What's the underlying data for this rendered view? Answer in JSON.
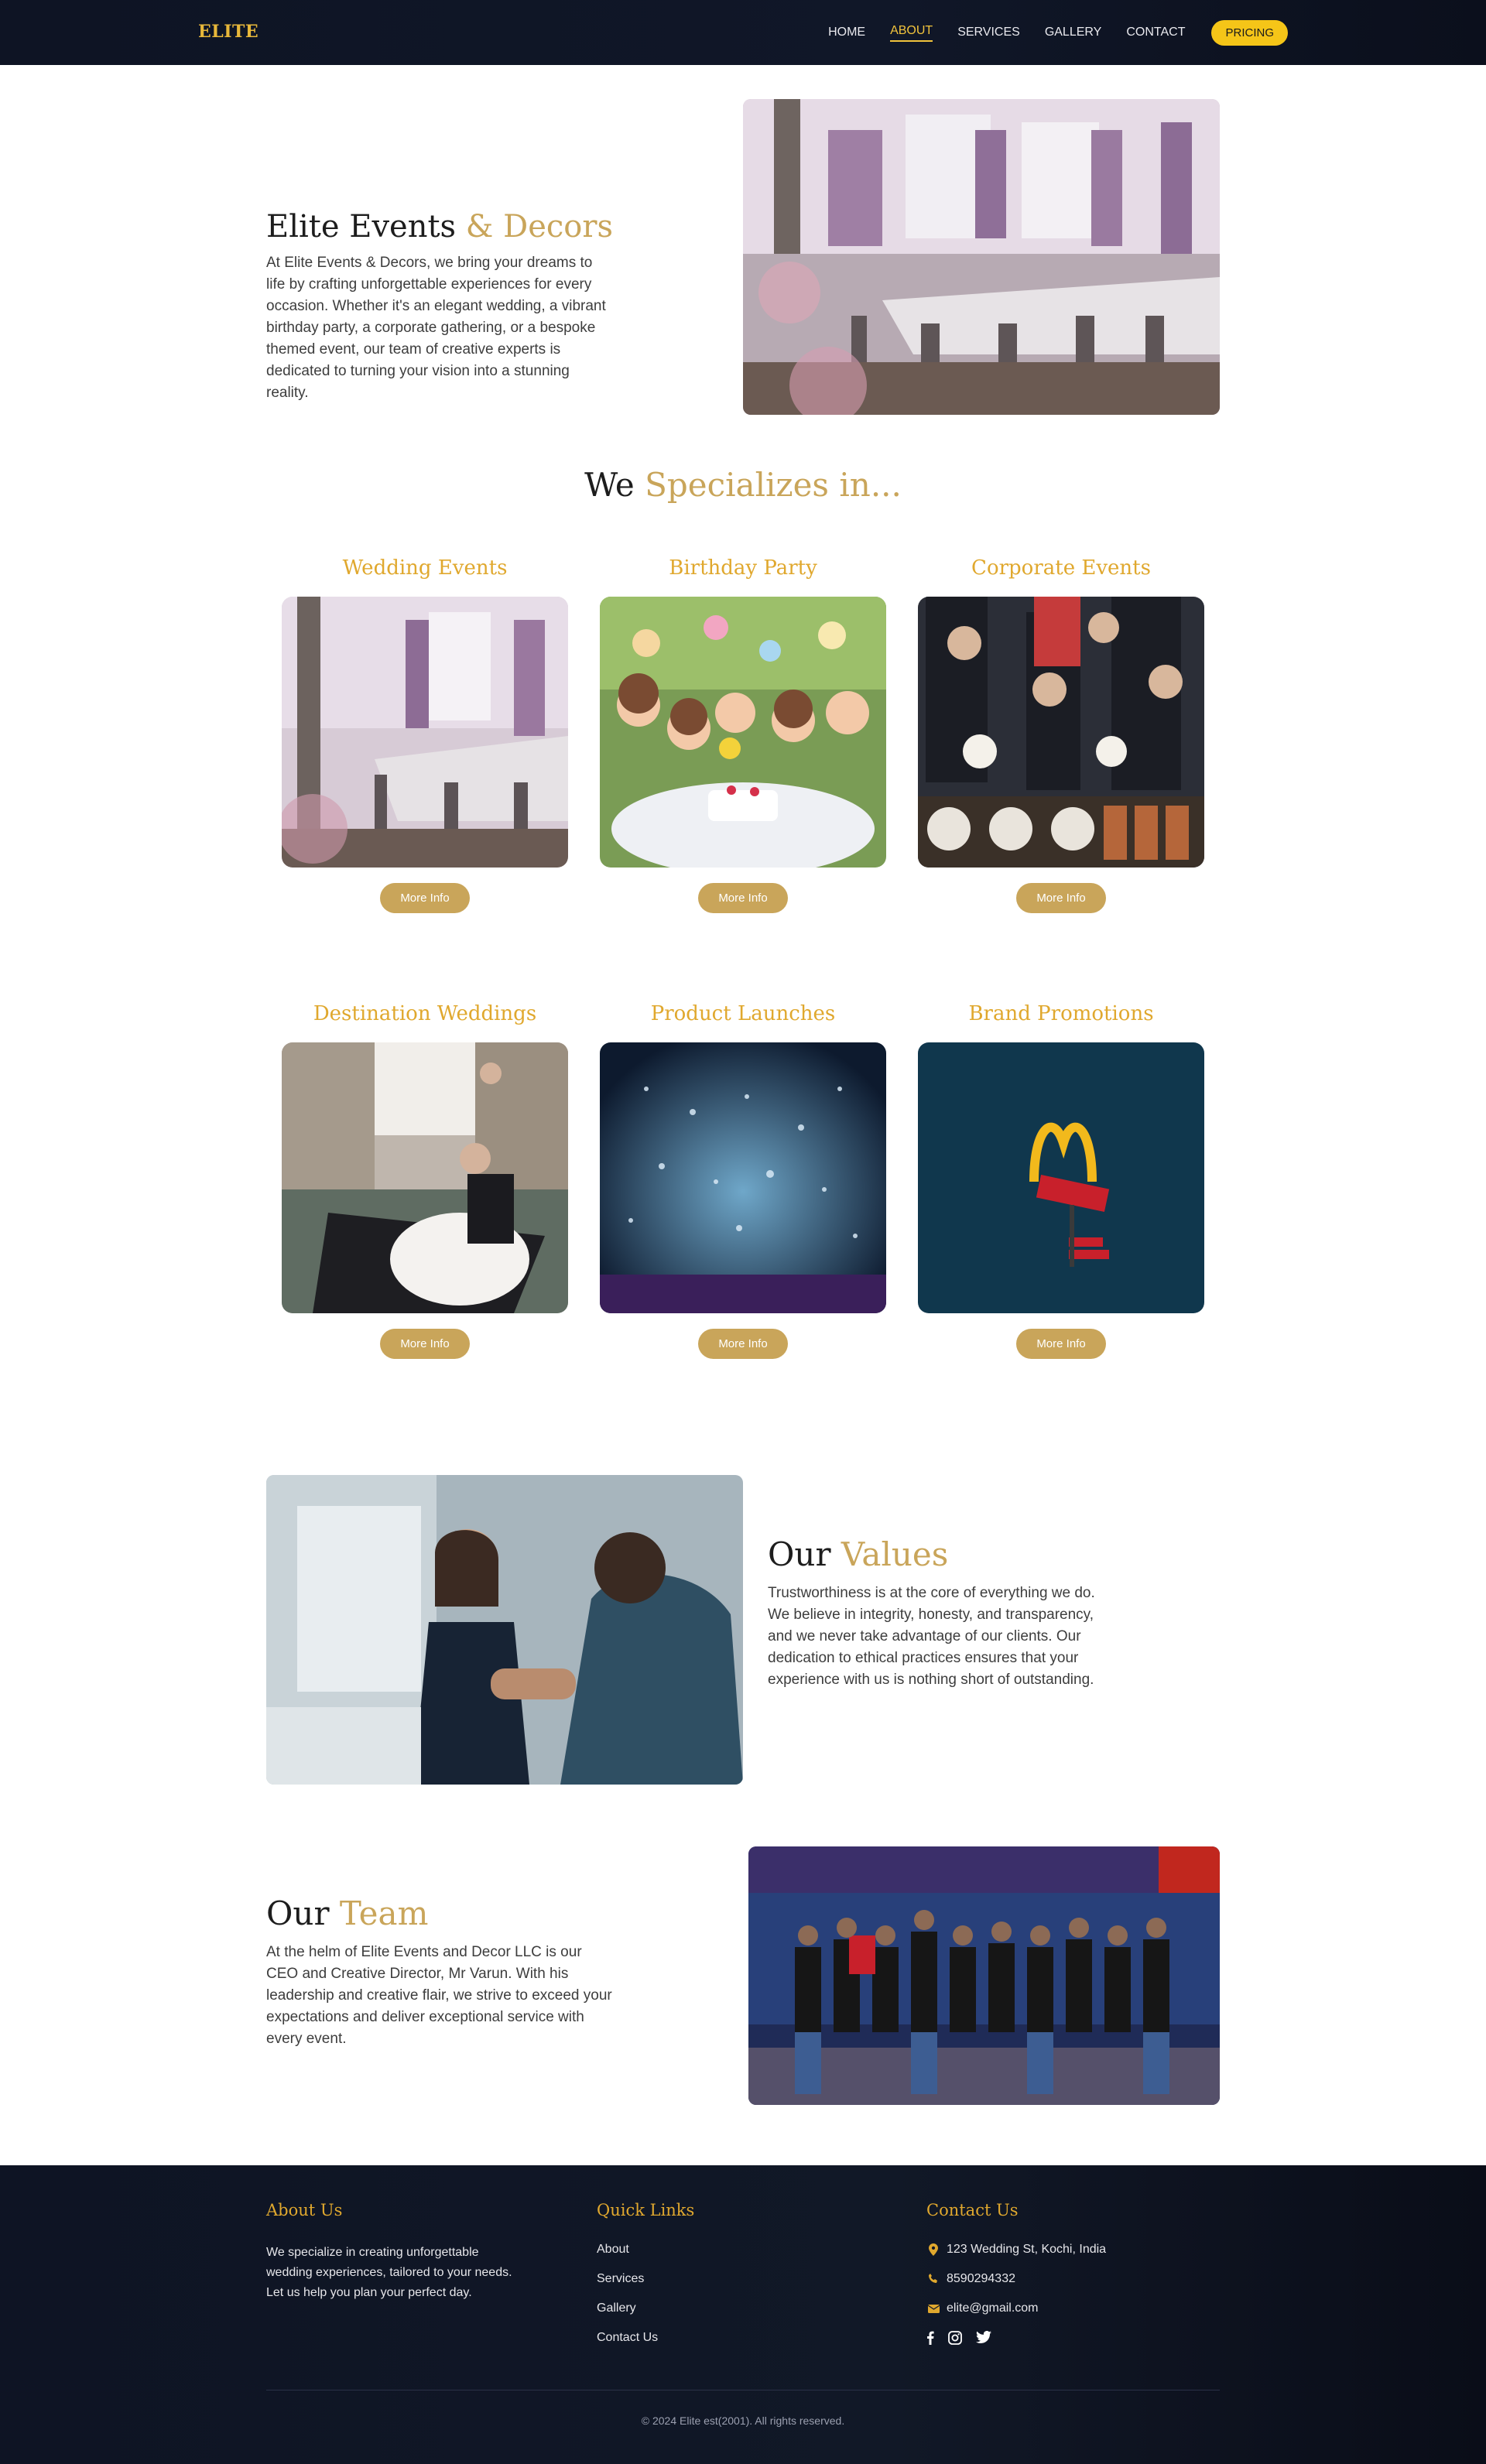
{
  "nav": {
    "logo": "ELITE",
    "links": [
      "HOME",
      "ABOUT",
      "SERVICES",
      "GALLERY",
      "CONTACT"
    ],
    "active": "ABOUT",
    "pricing": "PRICING"
  },
  "hero": {
    "title_a": "Elite Events",
    "title_b": "& Decors",
    "text": "At Elite Events & Decors, we bring your dreams to life by crafting unforgettable experiences for every occasion. Whether it's an elegant wedding, a vibrant birthday party, a corporate gathering, or a bespoke themed event, our team of creative experts is dedicated to turning your vision into a stunning reality."
  },
  "specializes": {
    "title_a": "We",
    "title_b": "Specializes in...",
    "more_label": "More Info",
    "cards": [
      {
        "title": "Wedding Events"
      },
      {
        "title": "Birthday Party"
      },
      {
        "title": "Corporate Events"
      },
      {
        "title": "Destination Weddings"
      },
      {
        "title": "Product Launches"
      },
      {
        "title": "Brand Promotions"
      }
    ]
  },
  "values": {
    "title_a": "Our",
    "title_b": "Values",
    "text": "Trustworthiness is at the core of everything we do. We believe in integrity, honesty, and transparency, and we never take advantage of our clients. Our dedication to ethical practices ensures that your experience with us is nothing short of outstanding."
  },
  "team": {
    "title_a": "Our",
    "title_b": "Team",
    "text": "At the helm of Elite Events and Decor LLC is our CEO and Creative Director, Mr Varun. With his leadership and creative flair, we strive to exceed your expectations and deliver exceptional service with every event."
  },
  "footer": {
    "about_title": "About Us",
    "about_text": "We specialize in creating unforgettable wedding experiences, tailored to your needs. Let us help you plan your perfect day.",
    "links_title": "Quick Links",
    "links": [
      "About",
      "Services",
      "Gallery",
      "Contact Us"
    ],
    "contact_title": "Contact Us",
    "address": "123 Wedding St, Kochi, India",
    "phone": "8590294332",
    "email": "elite@gmail.com",
    "copyright": "© 2024 Elite est(2001). All rights reserved."
  },
  "colors": {
    "gold": "#c9a55a",
    "heading_gold": "#e0a82e",
    "nav_bg": "#0e1424",
    "pricing_pill": "#f5c518"
  }
}
